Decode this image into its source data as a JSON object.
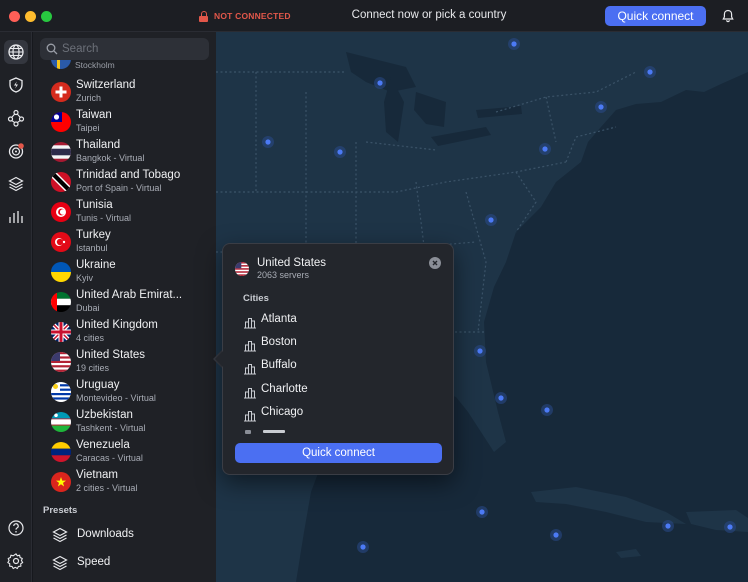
{
  "window": {
    "status": "NOT CONNECTED",
    "title": "Connect now or pick a country",
    "quick_connect": "Quick connect"
  },
  "search": {
    "placeholder": "Search"
  },
  "partial_item": {
    "sub": "Stockholm"
  },
  "countries": [
    {
      "name": "Switzerland",
      "sub": "Zurich",
      "flag": "switzerland-flag-icon"
    },
    {
      "name": "Taiwan",
      "sub": "Taipei",
      "flag": "taiwan-flag-icon"
    },
    {
      "name": "Thailand",
      "sub": "Bangkok - Virtual",
      "flag": "thailand-flag-icon"
    },
    {
      "name": "Trinidad and Tobago",
      "sub": "Port of Spain - Virtual",
      "flag": "trinidad-flag-icon"
    },
    {
      "name": "Tunisia",
      "sub": "Tunis - Virtual",
      "flag": "tunisia-flag-icon"
    },
    {
      "name": "Turkey",
      "sub": "Istanbul",
      "flag": "turkey-flag-icon"
    },
    {
      "name": "Ukraine",
      "sub": "Kyiv",
      "flag": "ukraine-flag-icon"
    },
    {
      "name": "United Arab Emirat...",
      "sub": "Dubai",
      "flag": "uae-flag-icon"
    },
    {
      "name": "United Kingdom",
      "sub": "4 cities",
      "flag": "uk-flag-icon"
    },
    {
      "name": "United States",
      "sub": "19 cities",
      "flag": "us-flag-icon"
    },
    {
      "name": "Uruguay",
      "sub": "Montevideo - Virtual",
      "flag": "uruguay-flag-icon"
    },
    {
      "name": "Uzbekistan",
      "sub": "Tashkent - Virtual",
      "flag": "uzbekistan-flag-icon"
    },
    {
      "name": "Venezuela",
      "sub": "Caracas - Virtual",
      "flag": "venezuela-flag-icon"
    },
    {
      "name": "Vietnam",
      "sub": "2 cities - Virtual",
      "flag": "vietnam-flag-icon"
    }
  ],
  "presets": {
    "label": "Presets",
    "items": [
      {
        "name": "Downloads"
      },
      {
        "name": "Speed"
      }
    ]
  },
  "popup": {
    "country": "United States",
    "servers": "2063 servers",
    "cities_label": "Cities",
    "cities": [
      "Atlanta",
      "Boston",
      "Buffalo",
      "Charlotte",
      "Chicago"
    ],
    "quick_connect": "Quick connect"
  },
  "map": {
    "zoom_out": "−",
    "zoom_in": "+"
  },
  "colors": {
    "accent": "#4b6ff2",
    "danger": "#e2574a",
    "map_water": "#17293a",
    "map_land": "#1e3447",
    "server_dot": "#3f6df0"
  }
}
